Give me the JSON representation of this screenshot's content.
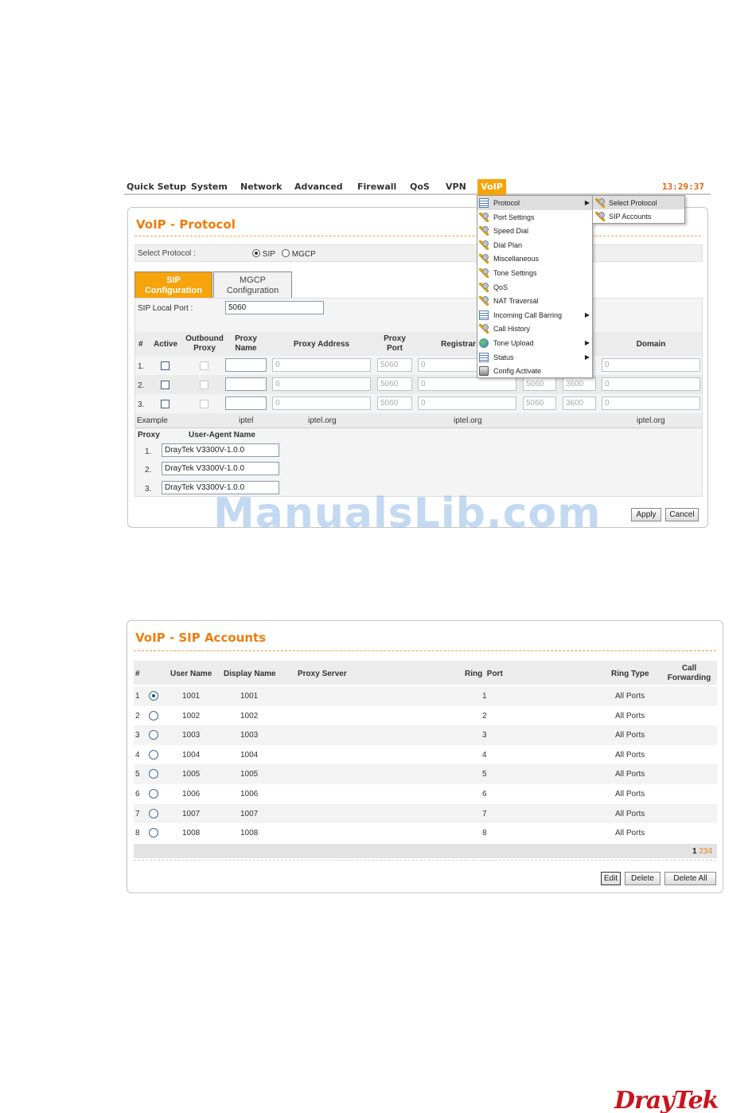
{
  "nav": {
    "items": [
      "Quick Setup",
      "System",
      "Network",
      "Advanced",
      "Firewall",
      "QoS",
      "VPN"
    ],
    "active": "VoIP",
    "clock": "13:29:37"
  },
  "menu": {
    "items": [
      {
        "label": "Protocol",
        "icon": "list-icon",
        "submenu": true,
        "highlighted": true
      },
      {
        "label": "Port Settings",
        "icon": "wrench-icon"
      },
      {
        "label": "Speed Dial",
        "icon": "wrench-icon"
      },
      {
        "label": "Dial Plan",
        "icon": "wrench-icon"
      },
      {
        "label": "Miscellaneous",
        "icon": "wrench-icon"
      },
      {
        "label": "Tone Settings",
        "icon": "wrench-icon"
      },
      {
        "label": "QoS",
        "icon": "wrench-icon"
      },
      {
        "label": "NAT Traversal",
        "icon": "wrench-icon"
      },
      {
        "label": "Incoming Call Barring",
        "icon": "list-icon",
        "submenu": true
      },
      {
        "label": "Call History",
        "icon": "wrench-icon"
      },
      {
        "label": "Tone Upload",
        "icon": "globe-icon",
        "submenu": true
      },
      {
        "label": "Status",
        "icon": "list-icon",
        "submenu": true
      },
      {
        "label": "Config Activate",
        "icon": "printer-icon"
      }
    ],
    "submenu": [
      {
        "label": "Select Protocol",
        "highlighted": true
      },
      {
        "label": "SIP Accounts"
      }
    ]
  },
  "protocol": {
    "title": "VoIP - Protocol",
    "select_label": "Select Protocol :",
    "opt_sip": "SIP",
    "opt_mgcp": "MGCP",
    "tab_sip_1": "SIP",
    "tab_sip_2": "Configuration",
    "tab_mgcp_1": "MGCP",
    "tab_mgcp_2": "Configuration",
    "local_port_label": "SIP Local Port :",
    "local_port": "5060",
    "headers": {
      "num": "#",
      "active": "Active",
      "outbound_1": "Outbound",
      "outbound_2": "Proxy",
      "proxy_name_1": "Proxy",
      "proxy_name_2": "Name",
      "proxy_address": "Proxy Address",
      "proxy_port_1": "Proxy",
      "proxy_port_2": "Port",
      "registrar": "Registrar A",
      "domain": "Domain"
    },
    "rows": [
      {
        "num": "1.",
        "proxy_address": "0",
        "proxy_port": "5060",
        "registrar": "0",
        "reg_port": "",
        "expire": "",
        "domain": "0"
      },
      {
        "num": "2.",
        "proxy_address": "0",
        "proxy_port": "5060",
        "registrar": "0",
        "reg_port": "5060",
        "expire": "3600",
        "domain": "0"
      },
      {
        "num": "3.",
        "proxy_address": "0",
        "proxy_port": "5060",
        "registrar": "0",
        "reg_port": "5060",
        "expire": "3600",
        "domain": "0"
      }
    ],
    "example_label": "Example",
    "example_proxy_name": "iptel",
    "example_proxy_address": "iptel.org",
    "example_registrar": "iptel.org",
    "example_domain": "iptel.org",
    "ua_header_proxy": "Proxy",
    "ua_header_name": "User-Agent Name",
    "ua_rows": [
      {
        "num": "1.",
        "value": "DrayTek V3300V-1.0.0"
      },
      {
        "num": "2.",
        "value": "DrayTek V3300V-1.0.0"
      },
      {
        "num": "3.",
        "value": "DrayTek V3300V-1.0.0"
      }
    ],
    "apply": "Apply",
    "cancel": "Cancel"
  },
  "watermark": "ManualsLib.com",
  "accounts": {
    "title": "VoIP - SIP Accounts",
    "headers": {
      "num": "#",
      "user": "User Name",
      "display": "Display Name",
      "proxy": "Proxy Server",
      "ring_port": "Ring  Port",
      "ring_type": "Ring Type",
      "cf_1": "Call",
      "cf_2": "Forwarding"
    },
    "rows": [
      {
        "num": "1",
        "user": "1001",
        "display": "1001",
        "port": "1",
        "type": "All Ports",
        "selected": true
      },
      {
        "num": "2",
        "user": "1002",
        "display": "1002",
        "port": "2",
        "type": "All Ports"
      },
      {
        "num": "3",
        "user": "1003",
        "display": "1003",
        "port": "3",
        "type": "All Ports"
      },
      {
        "num": "4",
        "user": "1004",
        "display": "1004",
        "port": "4",
        "type": "All Ports"
      },
      {
        "num": "5",
        "user": "1005",
        "display": "1005",
        "port": "5",
        "type": "All Ports"
      },
      {
        "num": "6",
        "user": "1006",
        "display": "1006",
        "port": "6",
        "type": "All Ports"
      },
      {
        "num": "7",
        "user": "1007",
        "display": "1007",
        "port": "7",
        "type": "All Ports"
      },
      {
        "num": "8",
        "user": "1008",
        "display": "1008",
        "port": "8",
        "type": "All Ports"
      }
    ],
    "pages": {
      "current": "1",
      "others": [
        "2",
        "3",
        "4"
      ]
    },
    "edit": "Edit",
    "delete": "Delete",
    "delete_all": "Delete All"
  },
  "brand": "DrayTek",
  "colors": {
    "accent": "#f7a30b",
    "title": "#ef7d0a",
    "brand": "#c9141d"
  }
}
